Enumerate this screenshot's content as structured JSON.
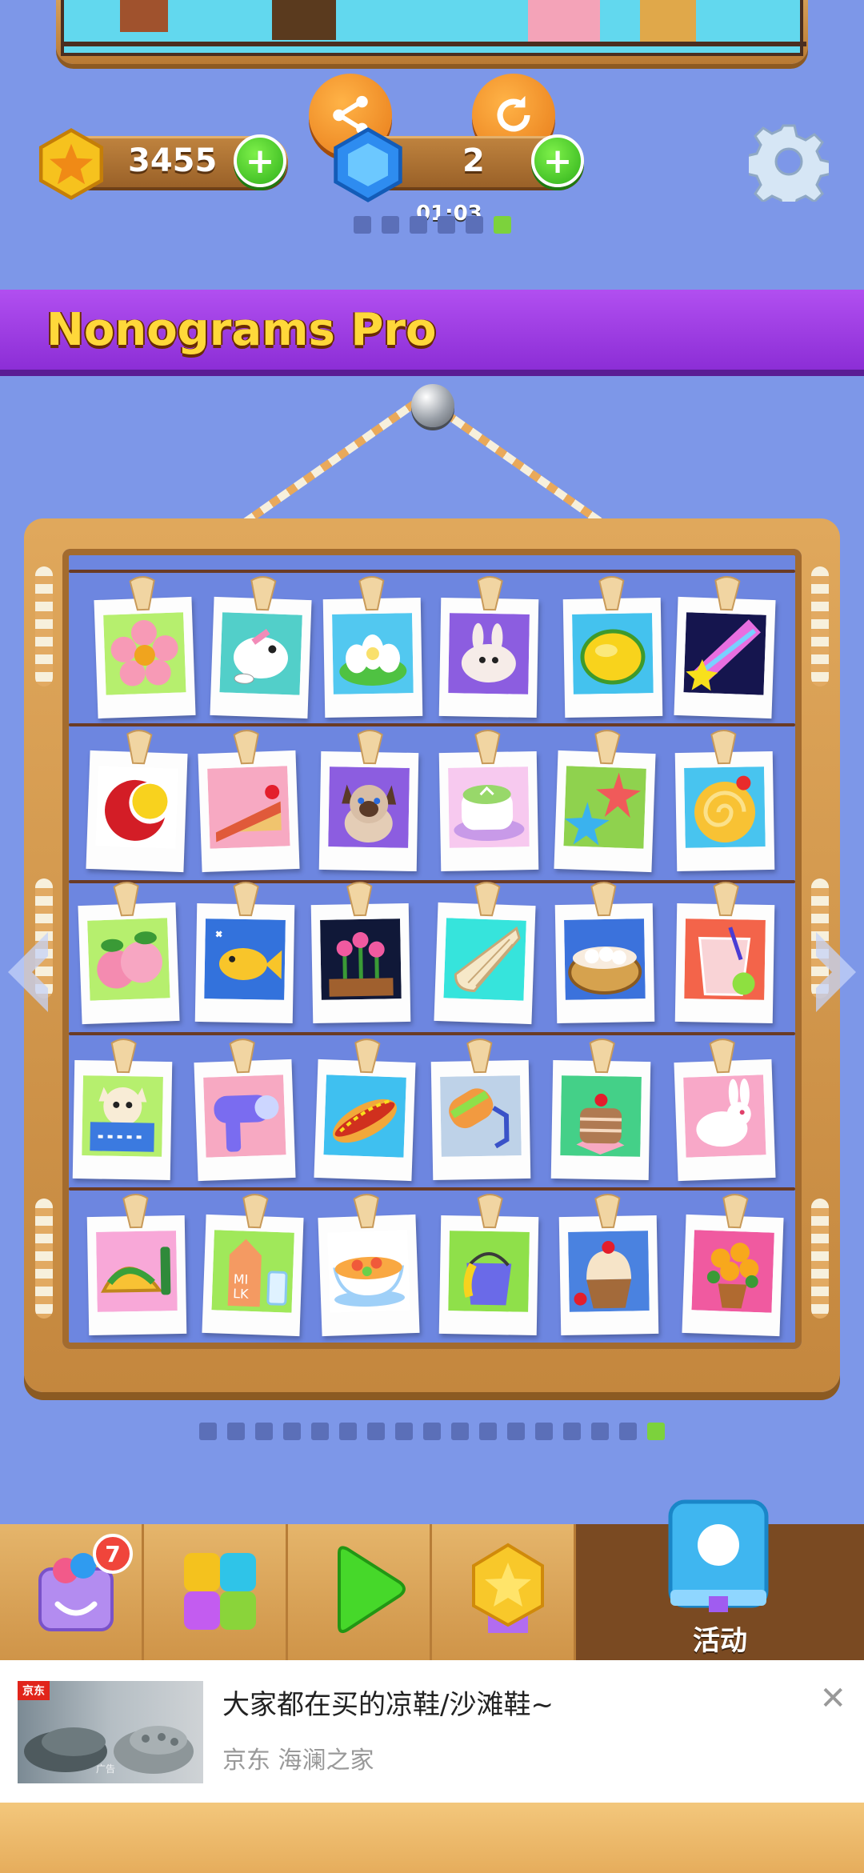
{
  "currencies": {
    "coins": "3455",
    "gems": "2"
  },
  "timer": "01:03",
  "progress_dots": {
    "count": 6,
    "active_index": 5
  },
  "banner": {
    "title": "Nonograms Pro"
  },
  "gallery": {
    "rows": [
      [
        "flower",
        "bird",
        "lotus",
        "rabbit",
        "lemon",
        "shooting-star"
      ],
      [
        "moon",
        "cake-slice",
        "cat",
        "latte",
        "starfish",
        "swiss-roll"
      ],
      [
        "peach",
        "fish",
        "tulips",
        "seashell",
        "steamed-buns",
        "lemonade"
      ],
      [
        "cat-in-basket",
        "hair-dryer",
        "hot-dog",
        "paint-roller",
        "layer-cake",
        "bunny"
      ],
      [
        "taco",
        "milk",
        "noodle-bowl",
        "paint-bucket",
        "cupcake",
        "potted-flowers"
      ]
    ]
  },
  "page_dots": {
    "count": 17,
    "active_index": 16
  },
  "bottom_nav": {
    "shop_badge": "7",
    "active_label": "活动"
  },
  "ad": {
    "tag": "京东",
    "image_badge": "广告",
    "title": "大家都在买的凉鞋/沙滩鞋~",
    "subtitle": "京东  海澜之家",
    "close": "✕"
  },
  "colors": {
    "banner": "#9b3fe3",
    "banner_text": "#ffd83a",
    "background": "#7d97e8",
    "active_dot": "#7cd23c"
  }
}
